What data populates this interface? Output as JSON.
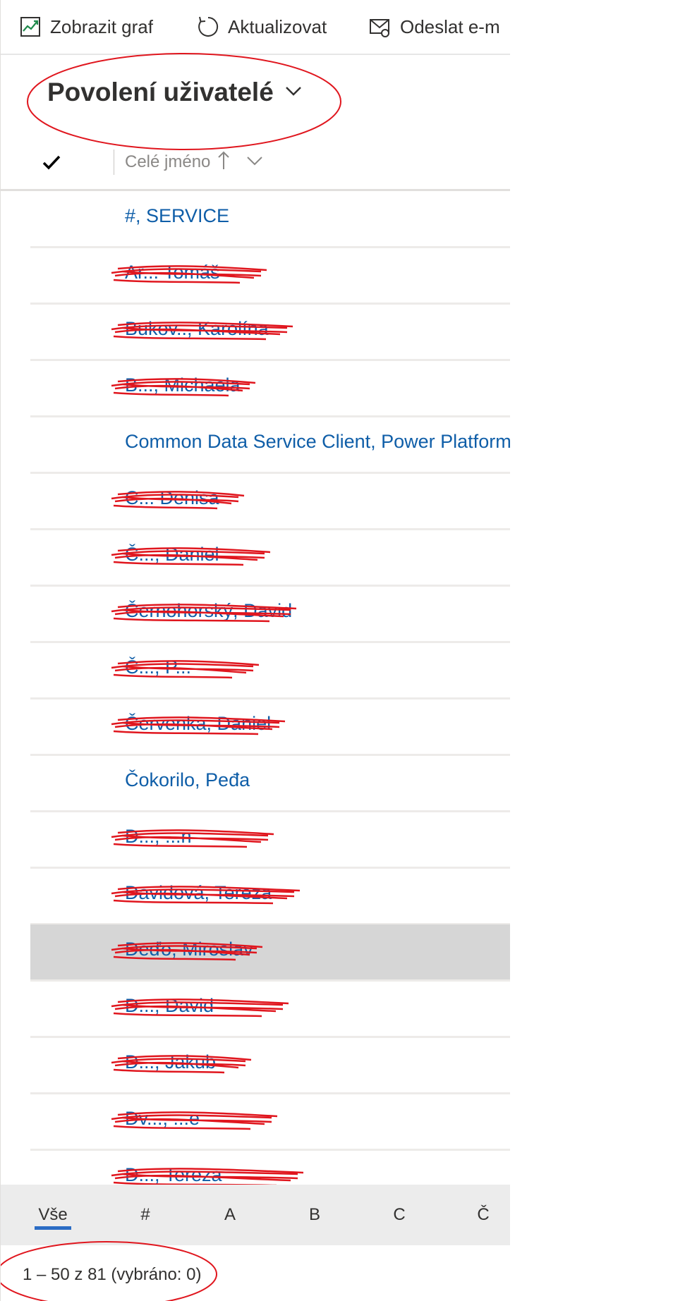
{
  "toolbar": {
    "show_chart_label": "Zobrazit graf",
    "refresh_label": "Aktualizovat",
    "send_email_label": "Odeslat e-m"
  },
  "view": {
    "title": "Povolení uživatelé"
  },
  "grid": {
    "column_header": "Celé jméno",
    "sort": "ascending",
    "rows": [
      {
        "name": "#, SERVICE",
        "redacted": false
      },
      {
        "name": "Ar... Tomáš",
        "redacted": true
      },
      {
        "name": "Bukov.., Karolína",
        "redacted": true
      },
      {
        "name": "B..., Michaela",
        "redacted": true
      },
      {
        "name": "Common Data Service Client, Power Platform",
        "redacted": false
      },
      {
        "name": "C... Denisa",
        "redacted": true
      },
      {
        "name": "Č..., Daniel",
        "redacted": true
      },
      {
        "name": "Černohorský, David",
        "redacted": true
      },
      {
        "name": "Č..., P...",
        "redacted": true
      },
      {
        "name": "Červenka, Daniel",
        "redacted": true
      },
      {
        "name": "Čokorilo, Peđa",
        "redacted": false
      },
      {
        "name": "D..., ...n",
        "redacted": true
      },
      {
        "name": "Davidová, Tereza",
        "redacted": true
      },
      {
        "name": "Deďo, Miroslav",
        "redacted": true,
        "selected": true
      },
      {
        "name": "D..., David",
        "redacted": true
      },
      {
        "name": "D..., Jakub",
        "redacted": true
      },
      {
        "name": "Dv..., ...e",
        "redacted": true
      },
      {
        "name": "D..., Tereza",
        "redacted": true
      }
    ]
  },
  "alphabet": {
    "items": [
      "Vše",
      "#",
      "A",
      "B",
      "C",
      "Č"
    ],
    "active": "Vše"
  },
  "status": {
    "text": "1 – 50 z 81 (vybráno: 0)"
  },
  "colors": {
    "link": "#0f5ea8",
    "annotation": "#e0161e",
    "selected_row": "#d6d6d6",
    "alpha_bar": "#ececec",
    "accent": "#2b6cc4"
  }
}
